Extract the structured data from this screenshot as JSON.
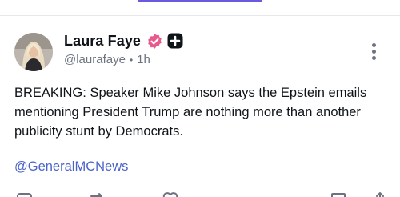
{
  "post": {
    "author": {
      "display_name": "Laura Faye",
      "handle": "@laurafaye",
      "time_ago": "1h",
      "separator": "•"
    },
    "text": "BREAKING: Speaker Mike Johnson says the Epstein emails mentioning President Trump are nothing more than another publicity stunt by Democrats.",
    "mention": "@GeneralMCNews"
  },
  "icons": {
    "verified": "verified-badge-icon",
    "plus": "plus-badge-icon",
    "more": "more-vertical-icon",
    "reply": "reply-icon",
    "repost": "repost-icon",
    "like": "heart-icon",
    "bookmark": "bookmark-icon",
    "share": "share-icon"
  },
  "colors": {
    "accent": "#6a5ae0",
    "verified_badge": "#e85a8c",
    "link": "#4a63c9",
    "muted_text": "#6b7280"
  }
}
